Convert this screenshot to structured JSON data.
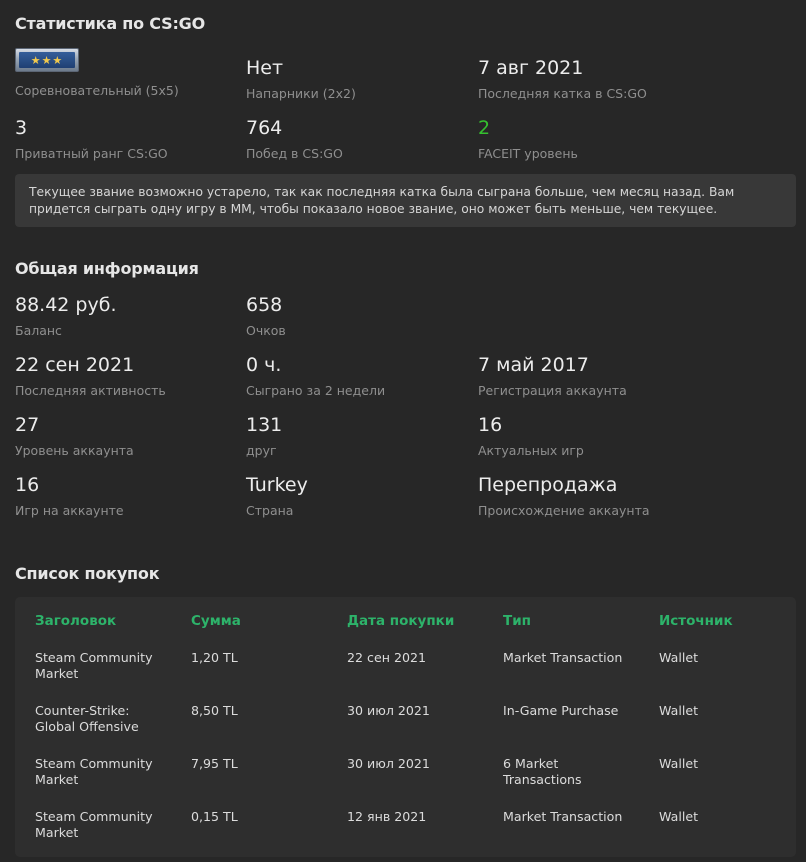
{
  "csgo": {
    "title": "Статистика по CS:GO",
    "rank_icon": "csgo-rank-gold-nova-icon",
    "competitive_label": "Соревновательный (5x5)",
    "wingman_value": "Нет",
    "wingman_label": "Напарники (2x2)",
    "last_match_value": "7 авг 2021",
    "last_match_label": "Последняя катка в CS:GO",
    "private_rank_value": "3",
    "private_rank_label": "Приватный ранг CS:GO",
    "wins_value": "764",
    "wins_label": "Побед в CS:GO",
    "faceit_value": "2",
    "faceit_label": "FACEIT уровень",
    "faceit_color": "#35c12f",
    "notice": "Текущее звание возможно устарело, так как последняя катка была сыграна больше, чем месяц назад. Вам придется сыграть одну игру в ММ, чтобы показало новое звание, оно может быть меньше, чем текущее."
  },
  "general": {
    "title": "Общая информация",
    "balance_value": "88.42 руб.",
    "balance_label": "Баланс",
    "points_value": "658",
    "points_label": "Очков",
    "last_activity_value": "22 сен 2021",
    "last_activity_label": "Последняя активность",
    "played_value": "0 ч.",
    "played_label": "Сыграно за 2 недели",
    "registration_value": "7 май 2017",
    "registration_label": "Регистрация аккаунта",
    "level_value": "27",
    "level_label": "Уровень аккаунта",
    "friends_value": "131",
    "friends_label": "друг",
    "relevant_games_value": "16",
    "relevant_games_label": "Актуальных игр",
    "games_value": "16",
    "games_label": "Игр на аккаунте",
    "country_value": "Turkey",
    "country_label": "Страна",
    "origin_value": "Перепродажа",
    "origin_label": "Происхождение аккаунта"
  },
  "purchases": {
    "title": "Список покупок",
    "header_color": "#2db36a",
    "headers": [
      "Заголовок",
      "Сумма",
      "Дата покупки",
      "Тип",
      "Источник"
    ],
    "rows": [
      {
        "title": "Steam Community Market",
        "sum": "1,20 TL",
        "date": "22 сен 2021",
        "type": "Market Transaction",
        "source": "Wallet"
      },
      {
        "title": "Counter-Strike: Global Offensive",
        "sum": "8,50 TL",
        "date": "30 июл 2021",
        "type": "In-Game Purchase",
        "source": "Wallet"
      },
      {
        "title": "Steam Community Market",
        "sum": "7,95 TL",
        "date": "30 июл 2021",
        "type": "6 Market Transactions",
        "source": "Wallet"
      },
      {
        "title": "Steam Community Market",
        "sum": "0,15 TL",
        "date": "12 янв 2021",
        "type": "Market Transaction",
        "source": "Wallet"
      }
    ]
  }
}
